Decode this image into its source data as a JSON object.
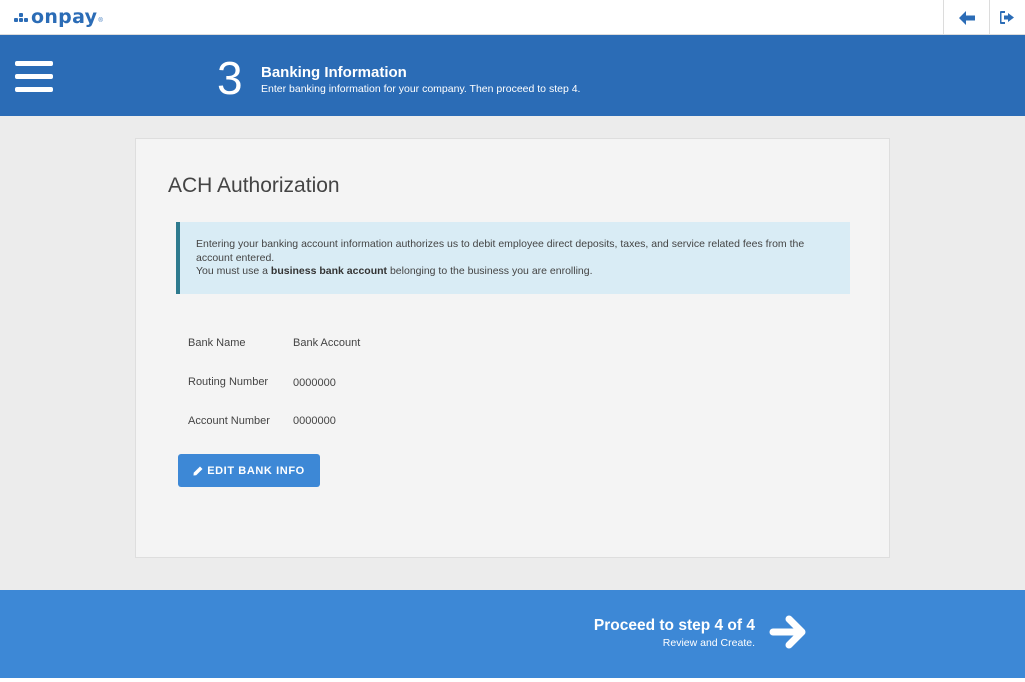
{
  "app": {
    "logo_text": "onpay",
    "logo_mark": "®"
  },
  "topbar": {
    "back_icon": "arrow-left-icon",
    "logout_icon": "sign-out-icon",
    "accent": "#2b6cb6"
  },
  "header": {
    "step_number": "3",
    "title": "Banking Information",
    "subtitle": "Enter banking information for your company. Then proceed to step 4.",
    "background": "#2b6cb6"
  },
  "card": {
    "title": "ACH Authorization",
    "info": {
      "line1": "Entering your banking account information authorizes us to debit employee direct deposits, taxes, and service related fees from the account entered.",
      "line2_prefix": "You must use a ",
      "line2_bold": "business bank account",
      "line2_suffix": " belonging to the business you are enrolling."
    },
    "fields": [
      {
        "label": "Bank Name",
        "value": "Bank Account"
      },
      {
        "label": "Routing Number",
        "value": "0000000"
      },
      {
        "label": "Account Number",
        "value": "0000000"
      }
    ],
    "edit_button": "EDIT BANK INFO"
  },
  "footer": {
    "proceed_title": "Proceed to step 4 of 4",
    "proceed_sub": "Review and Create.",
    "background": "#3d88d6"
  }
}
